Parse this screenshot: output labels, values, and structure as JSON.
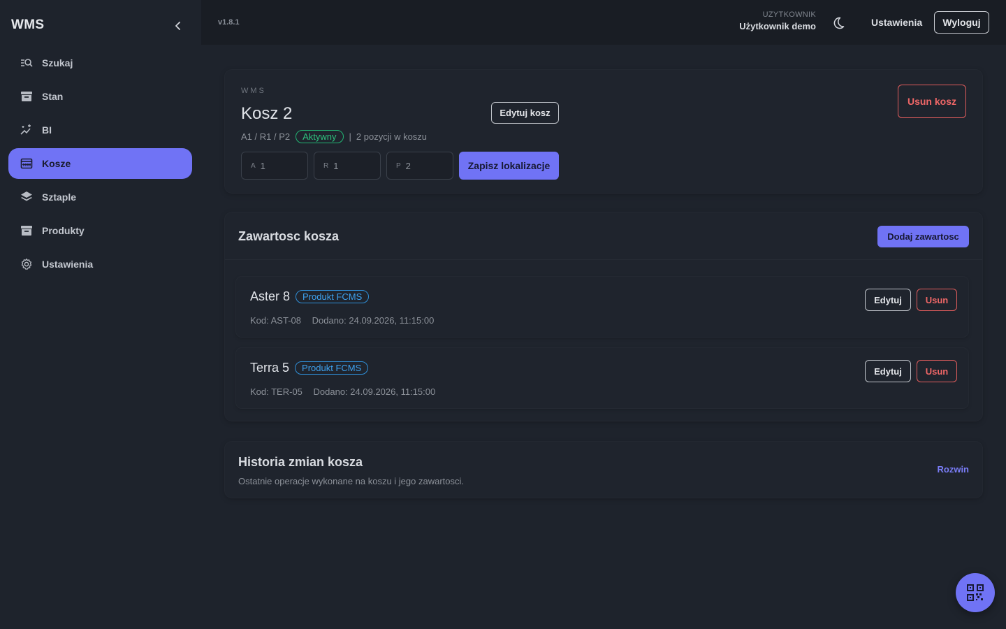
{
  "app": {
    "brand": "WMS",
    "version": "v1.8.1"
  },
  "sidebar": {
    "items": [
      {
        "label": "Szukaj",
        "icon": "search-list-icon"
      },
      {
        "label": "Stan",
        "icon": "archive-icon"
      },
      {
        "label": "BI",
        "icon": "chart-sparkle-icon"
      },
      {
        "label": "Kosze",
        "icon": "basket-grid-icon",
        "active": true
      },
      {
        "label": "Sztaple",
        "icon": "layers-icon"
      },
      {
        "label": "Produkty",
        "icon": "archive-icon"
      },
      {
        "label": "Ustawienia",
        "icon": "gear-icon"
      }
    ]
  },
  "topbar": {
    "user_caption": "UZYTKOWNIK",
    "user_name": "Użytkownik demo",
    "settings_label": "Ustawienia",
    "logout_label": "Wyloguj"
  },
  "kosz": {
    "eyebrow": "WMS",
    "title": "Kosz 2",
    "location": "A1 / R1 / P2",
    "status": "Aktywny",
    "separator": "|",
    "count_text": "2 pozycji w koszu",
    "edit_label": "Edytuj kosz",
    "delete_label": "Usun kosz",
    "save_location_label": "Zapisz lokalizacje",
    "fields": [
      {
        "label": "A",
        "value": "1"
      },
      {
        "label": "R",
        "value": "1"
      },
      {
        "label": "P",
        "value": "2"
      }
    ]
  },
  "content": {
    "title": "Zawartosc kosza",
    "add_label": "Dodaj zawartosc",
    "items": [
      {
        "name": "Aster 8",
        "badge": "Produkt FCMS",
        "code": "Kod: AST-08",
        "added": "Dodano: 24.09.2026, 11:15:00",
        "edit_label": "Edytuj",
        "delete_label": "Usun"
      },
      {
        "name": "Terra 5",
        "badge": "Produkt FCMS",
        "code": "Kod: TER-05",
        "added": "Dodano: 24.09.2026, 11:15:00",
        "edit_label": "Edytuj",
        "delete_label": "Usun"
      }
    ]
  },
  "history": {
    "title": "Historia zmian kosza",
    "subtitle": "Ostatnie operacje wykonane na koszu i jego zawartosci.",
    "expand_label": "Rozwin"
  },
  "colors": {
    "accent": "#7073f5",
    "danger": "#f06767",
    "success": "#2ec27e",
    "info": "#3ea1ee"
  },
  "fab": {
    "icon": "qr-scan-icon"
  }
}
